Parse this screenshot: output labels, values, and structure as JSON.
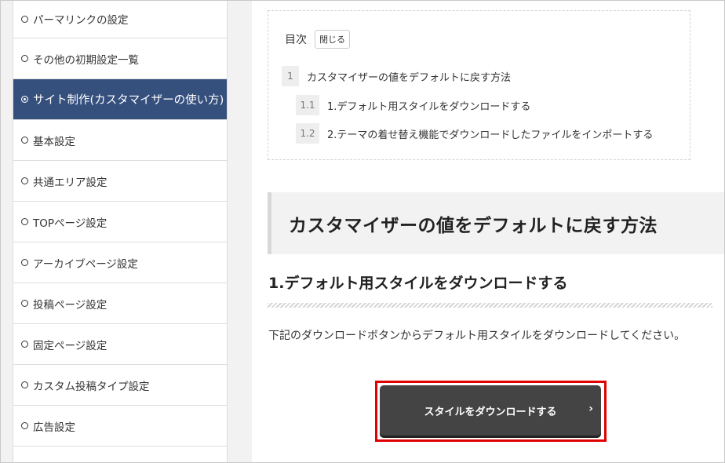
{
  "sidebar": {
    "items": [
      {
        "label": "パーマリンクの設定",
        "active": false
      },
      {
        "label": "その他の初期設定一覧",
        "active": false
      },
      {
        "label": "サイト制作(カスタマイザーの使い方)",
        "active": true
      },
      {
        "label": "基本設定",
        "active": false
      },
      {
        "label": "共通エリア設定",
        "active": false
      },
      {
        "label": "TOPページ設定",
        "active": false
      },
      {
        "label": "アーカイブページ設定",
        "active": false
      },
      {
        "label": "投稿ページ設定",
        "active": false
      },
      {
        "label": "固定ページ設定",
        "active": false
      },
      {
        "label": "カスタム投稿タイプ設定",
        "active": false
      },
      {
        "label": "広告設定",
        "active": false
      }
    ],
    "active_color": "#36507e"
  },
  "toc": {
    "title": "目次",
    "toggle_label": "閉じる",
    "items": [
      {
        "num": "1",
        "label": "カスタマイザーの値をデフォルトに戻す方法"
      },
      {
        "num": "1.1",
        "label": "1.デフォルト用スタイルをダウンロードする"
      },
      {
        "num": "1.2",
        "label": "2.テーマの着せ替え機能でダウンロードしたファイルをインポートする"
      }
    ]
  },
  "article": {
    "h2": "カスタマイザーの値をデフォルトに戻す方法",
    "h3": "1.デフォルト用スタイルをダウンロードする",
    "paragraph": "下記のダウンロードボタンからデフォルト用スタイルをダウンロードしてください。",
    "download_button": "スタイルをダウンロードする",
    "chevron": "›",
    "highlight_color": "#e00000"
  }
}
